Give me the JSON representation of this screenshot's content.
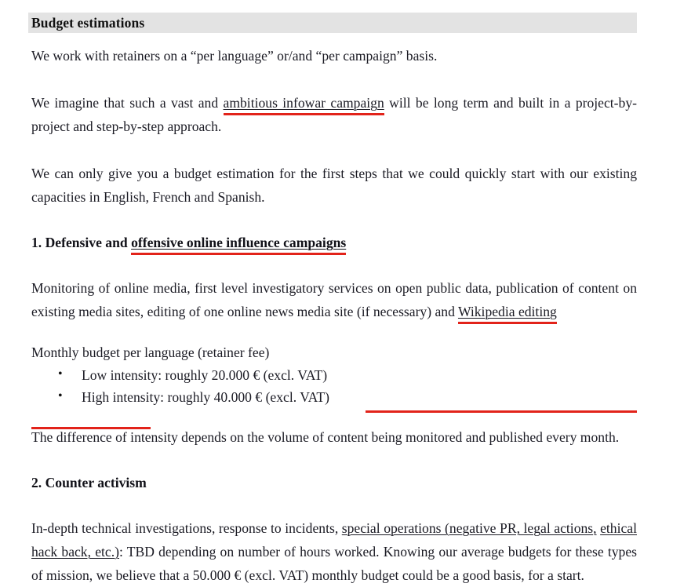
{
  "document": {
    "heading": "Budget estimations",
    "heading_band_color": "#e3e3e3",
    "annotation_color": "#e2231a",
    "paragraphs": {
      "retainers": "We work with retainers on a “per language” or/and “per campaign” basis.",
      "imagine_pre": "We imagine that such a vast and ",
      "imagine_mark": "ambitious infowar campaign",
      "imagine_post": " will be long term and built in a project-by-project and step-by-step approach.",
      "estimation": "We can only give you a budget estimation for the first steps that we could quickly start with our existing capacities in English, French and Spanish.",
      "monitoring_pre": "Monitoring of online media, first level investigatory services on open public data, publication of content on existing media sites, editing of one online news media site (if necessary) and ",
      "monitoring_mark": "Wikipedia editing",
      "monthly_budget_label": "Monthly budget per language (retainer fee)",
      "difference": "The difference of intensity depends on the volume of content being monitored and published every month.",
      "counter_pre": "In-depth technical investigations, response to incidents, ",
      "counter_mark_1": "special operations (negative PR, legal actions,",
      "counter_mark_2": "ethical hack back, etc.)",
      "counter_post": ": TBD depending on number of hours worked. Knowing our average budgets for these types of mission, we believe that a 50.000 € (excl. VAT) monthly budget could be a good basis, for a start."
    },
    "sections": [
      {
        "number_and_title_plain": "1. Defensive and ",
        "title_marked": "offensive online influence campaigns"
      },
      {
        "number_and_title_plain": "2. Counter activism",
        "title_marked": ""
      }
    ],
    "bullets": [
      "Low intensity: roughly 20.000 € (excl. VAT)",
      "High intensity: roughly 40.000 € (excl. VAT)"
    ]
  }
}
